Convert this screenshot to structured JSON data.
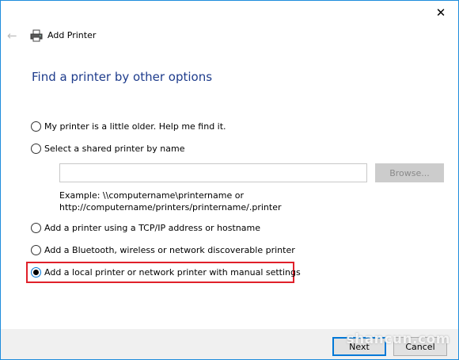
{
  "window": {
    "title": "Add Printer",
    "close_glyph": "✕",
    "back_glyph": "←"
  },
  "heading": "Find a printer by other options",
  "options": [
    {
      "label": "My printer is a little older. Help me find it.",
      "checked": false
    },
    {
      "label": "Select a shared printer by name",
      "checked": false
    },
    {
      "label": "Add a printer using a TCP/IP address or hostname",
      "checked": false
    },
    {
      "label": "Add a Bluetooth, wireless or network discoverable printer",
      "checked": false
    },
    {
      "label": "Add a local printer or network printer with manual settings",
      "checked": true
    }
  ],
  "shared": {
    "input_value": "",
    "browse_label": "Browse...",
    "example_line1": "Example: \\\\computername\\printername or",
    "example_line2": "http://computername/printers/printername/.printer"
  },
  "footer": {
    "next_label": "Next",
    "cancel_label": "Cancel"
  },
  "watermark": "shancun.com",
  "colors": {
    "accent": "#0078d7",
    "heading": "#1e3c8c",
    "highlight": "#e0202a"
  },
  "icons": {
    "printer": "printer-icon",
    "back": "back-arrow-icon",
    "close": "close-icon"
  }
}
